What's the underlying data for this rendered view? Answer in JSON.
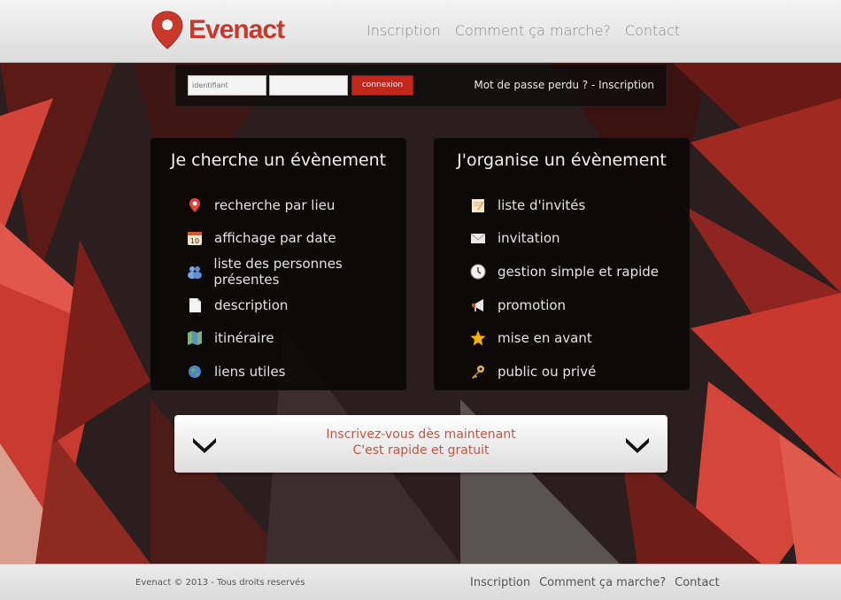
{
  "brand": {
    "name": "Evenact",
    "color": "#c8392b"
  },
  "nav": [
    "Inscription",
    "Comment ça marche?",
    "Contact"
  ],
  "login": {
    "id_placeholder": "identifiant",
    "pw_value": "",
    "submit_label": "connexion",
    "lost_text": "Mot de passe perdu ? - Inscription"
  },
  "left_panel": {
    "title": "Je cherche un évènement",
    "items": [
      {
        "label": "recherche par lieu",
        "icon": "map-pin-icon"
      },
      {
        "label": "affichage par date",
        "icon": "calendar-icon"
      },
      {
        "label": "liste des personnes présentes",
        "icon": "people-icon"
      },
      {
        "label": "description",
        "icon": "document-icon"
      },
      {
        "label": "itinéraire",
        "icon": "map-icon"
      },
      {
        "label": "liens utiles",
        "icon": "globe-icon"
      }
    ]
  },
  "right_panel": {
    "title": "J'organise un évènement",
    "items": [
      {
        "label": "liste d'invités",
        "icon": "notepad-icon"
      },
      {
        "label": "invitation",
        "icon": "envelope-icon"
      },
      {
        "label": "gestion simple et rapide",
        "icon": "clock-icon"
      },
      {
        "label": "promotion",
        "icon": "megaphone-icon"
      },
      {
        "label": "mise en avant",
        "icon": "star-icon"
      },
      {
        "label": "public ou privé",
        "icon": "key-icon"
      }
    ]
  },
  "cta": {
    "line1": "Inscrivez-vous dès maintenant",
    "line2": "C'est rapide et gratuit"
  },
  "footer": {
    "copyright": "Evenact © 2013 - Tous droits reservés",
    "nav": [
      "Inscription",
      "Comment ça marche?",
      "Contact"
    ]
  }
}
